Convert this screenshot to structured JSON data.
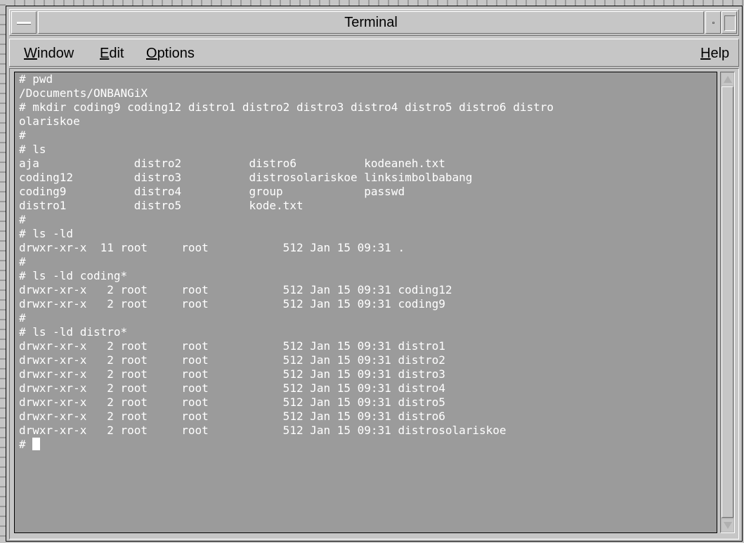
{
  "window": {
    "title": "Terminal"
  },
  "menubar": {
    "items": [
      {
        "mnemonic": "W",
        "rest": "indow"
      },
      {
        "mnemonic": "E",
        "rest": "dit"
      },
      {
        "mnemonic": "O",
        "rest": "ptions"
      }
    ],
    "help": {
      "pre": "",
      "mnemonic": "H",
      "rest": "elp"
    }
  },
  "terminal": {
    "lines": [
      "# pwd",
      "/Documents/ONBANGiX",
      "# mkdir coding9 coding12 distro1 distro2 distro3 distro4 distro5 distro6 distro",
      "olariskoe",
      "#",
      "# ls",
      "aja              distro2          distro6          kodeaneh.txt",
      "coding12         distro3          distrosolariskoe linksimbolbabang",
      "coding9          distro4          group            passwd",
      "distro1          distro5          kode.txt",
      "#",
      "# ls -ld",
      "drwxr-xr-x  11 root     root           512 Jan 15 09:31 .",
      "#",
      "# ls -ld coding*",
      "drwxr-xr-x   2 root     root           512 Jan 15 09:31 coding12",
      "drwxr-xr-x   2 root     root           512 Jan 15 09:31 coding9",
      "#",
      "# ls -ld distro*",
      "drwxr-xr-x   2 root     root           512 Jan 15 09:31 distro1",
      "drwxr-xr-x   2 root     root           512 Jan 15 09:31 distro2",
      "drwxr-xr-x   2 root     root           512 Jan 15 09:31 distro3",
      "drwxr-xr-x   2 root     root           512 Jan 15 09:31 distro4",
      "drwxr-xr-x   2 root     root           512 Jan 15 09:31 distro5",
      "drwxr-xr-x   2 root     root           512 Jan 15 09:31 distro6",
      "drwxr-xr-x   2 root     root           512 Jan 15 09:31 distrosolariskoe"
    ],
    "prompt": "# ",
    "colors": {
      "background": "#9b9b9b",
      "foreground": "#ffffff"
    }
  }
}
